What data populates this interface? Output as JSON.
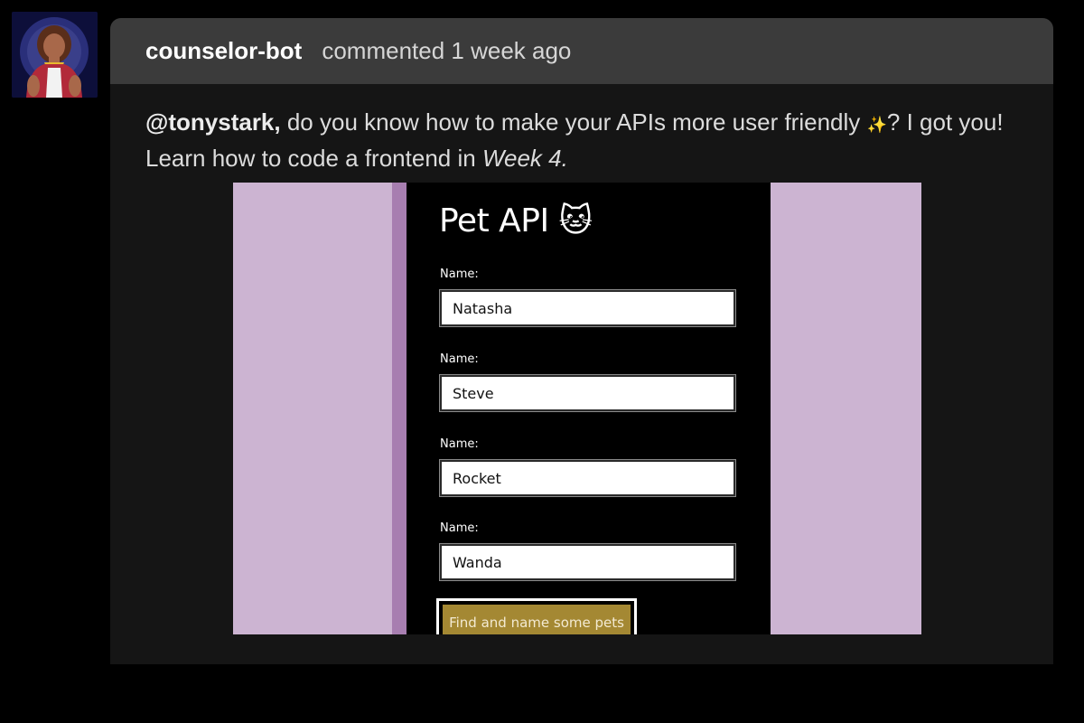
{
  "comment": {
    "author": "counselor-bot",
    "meta": "commented 1 week ago",
    "mention": "@tonystark,",
    "text_part1": " do you know how to make your APIs more user friendly ",
    "sparkle": "✨",
    "text_part2": "? I got you!",
    "line2_prefix": "Learn how to code a frontend in ",
    "line2_emphasis": "Week 4."
  },
  "demo": {
    "title": "Pet API 🐱",
    "fields": [
      {
        "label": "Name:",
        "value": "Natasha"
      },
      {
        "label": "Name:",
        "value": "Steve"
      },
      {
        "label": "Name:",
        "value": "Rocket"
      },
      {
        "label": "Name:",
        "value": "Wanda"
      }
    ],
    "button_label": "Find and name some pets"
  },
  "colors": {
    "page_bg": "#000000",
    "card_header_bg": "#3b3b3b",
    "card_body_bg": "#151515",
    "demo_side_bg": "#ccb4d2",
    "demo_strip": "#a77eb0",
    "demo_button": "#a48833"
  },
  "icons": {
    "avatar": "counselor-avatar-icon"
  }
}
